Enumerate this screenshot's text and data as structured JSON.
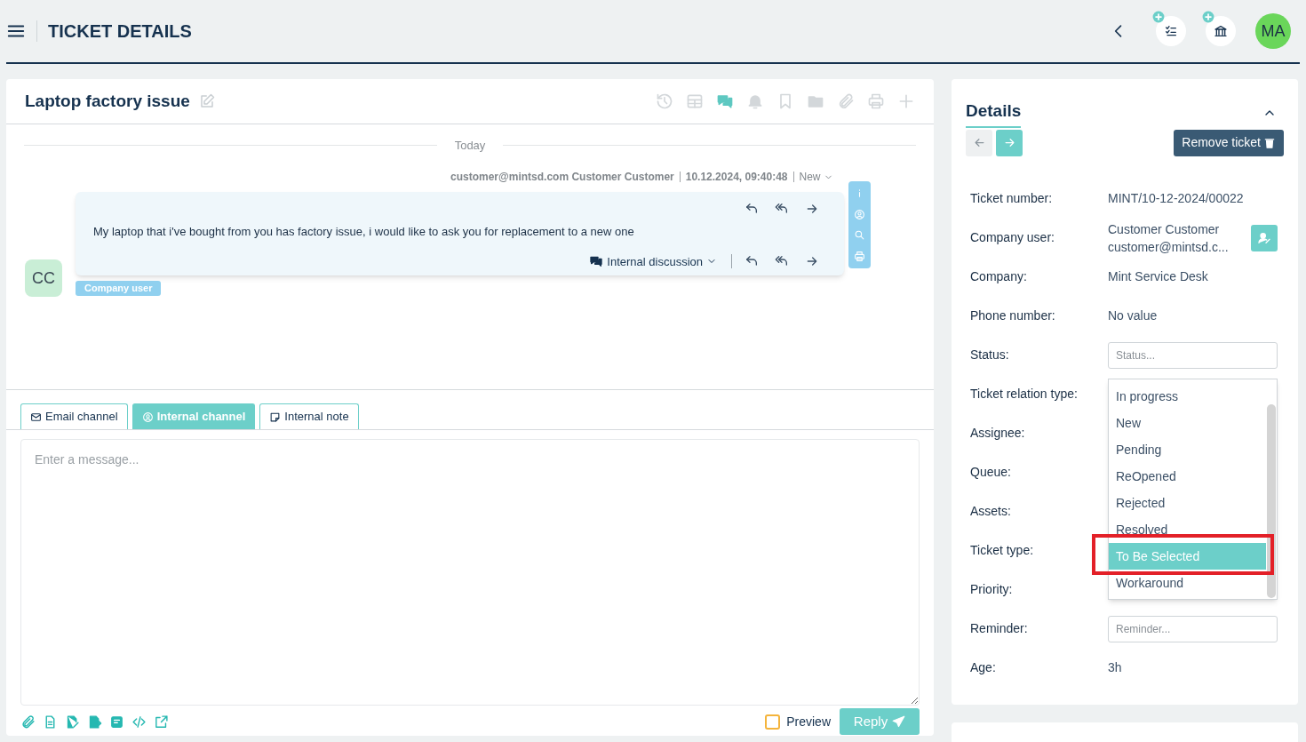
{
  "header": {
    "title": "TICKET DETAILS",
    "avatar": "MA"
  },
  "ticket": {
    "title": "Laptop factory issue",
    "toolbar": [
      {
        "kind": "history",
        "selected": false
      },
      {
        "kind": "table",
        "selected": false
      },
      {
        "kind": "chat",
        "selected": true
      },
      {
        "kind": "bell",
        "selected": false
      },
      {
        "kind": "bookmark",
        "selected": false
      },
      {
        "kind": "folder",
        "selected": false
      },
      {
        "kind": "attach",
        "selected": false
      },
      {
        "kind": "print",
        "selected": false
      },
      {
        "kind": "plus",
        "selected": false
      }
    ]
  },
  "thread": {
    "date_divider": "Today",
    "sender": "customer@mintsd.com Customer Customer",
    "timestamp": "10.12.2024, 09:40:48",
    "status": "New",
    "message": "My laptop that i've bought from you has factory issue, i would like to ask you for replacement to a new one",
    "discussion": "Internal discussion",
    "avatar": "CC",
    "role_badge": "Company user"
  },
  "composer": {
    "tabs": [
      {
        "kind": "email",
        "label": "Email channel",
        "selected": false
      },
      {
        "kind": "internal",
        "label": "Internal channel",
        "selected": true
      },
      {
        "kind": "note",
        "label": "Internal note",
        "selected": false
      }
    ],
    "placeholder": "Enter a message...",
    "preview": {
      "label": "Preview",
      "checked": false
    },
    "reply": "Reply"
  },
  "details": {
    "title": "Details",
    "remove": "Remove ticket",
    "fields": [
      {
        "label": "Ticket number:",
        "kind": "text",
        "value": "MINT/10-12-2024/00022"
      },
      {
        "label": "Company user:",
        "kind": "user",
        "value": "Customer Customer",
        "value_2": "customer@mintsd.c..."
      },
      {
        "label": "Company:",
        "kind": "text",
        "value": "Mint Service Desk"
      },
      {
        "label": "Phone number:",
        "kind": "text",
        "value": "No value"
      },
      {
        "label": "Status:",
        "kind": "input",
        "placeholder": "Status..."
      },
      {
        "label": "Ticket relation type:",
        "kind": "covered"
      },
      {
        "label": "Assignee:",
        "kind": "covered"
      },
      {
        "label": "Queue:",
        "kind": "covered"
      },
      {
        "label": "Assets:",
        "kind": "covered"
      },
      {
        "label": "Ticket type:",
        "kind": "covered"
      },
      {
        "label": "Priority:",
        "kind": "covered"
      },
      {
        "label": "Reminder:",
        "kind": "input",
        "placeholder": "Reminder..."
      },
      {
        "label": "Age:",
        "kind": "text",
        "value": "3h"
      }
    ],
    "dropdown": {
      "options": [
        {
          "label": "In progress",
          "selected": false
        },
        {
          "label": "New",
          "selected": false
        },
        {
          "label": "Pending",
          "selected": false
        },
        {
          "label": "ReOpened",
          "selected": false
        },
        {
          "label": "Rejected",
          "selected": false
        },
        {
          "label": "Resolved",
          "selected": false
        },
        {
          "label": "To Be Selected",
          "selected": true
        },
        {
          "label": "Workaround",
          "selected": false
        }
      ]
    }
  }
}
